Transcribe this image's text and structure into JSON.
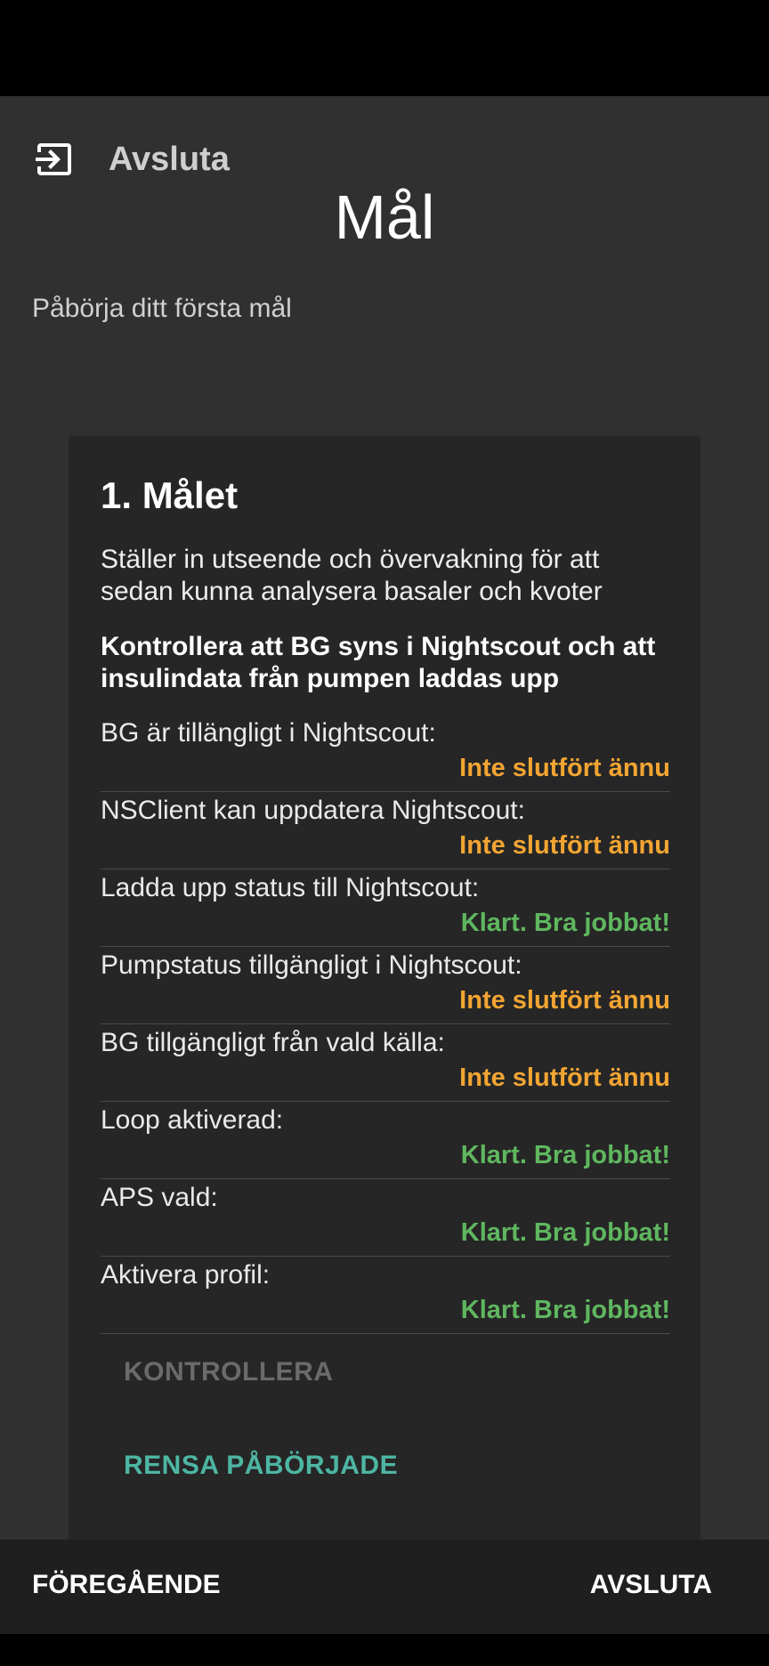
{
  "header": {
    "exit_label": "Avsluta",
    "title": "Mål",
    "subtitle": "Påbörja ditt första mål"
  },
  "objective": {
    "title": "1. Målet",
    "description": "Ställer in utseende och övervakning för att sedan kunna analysera basaler och kvoter",
    "instruction": "Kontrollera att BG syns i Nightscout och att insulindata från pumpen laddas upp",
    "tasks": [
      {
        "label": "BG är tillängligt i Nightscout:",
        "status": "Inte slutfört ännu"
      },
      {
        "label": "NSClient kan uppdatera Nightscout:",
        "status": "Inte slutfört ännu"
      },
      {
        "label": "Ladda upp status till Nightscout:",
        "status": "Klart. Bra jobbat!"
      },
      {
        "label": "Pumpstatus tillgängligt i Nightscout:",
        "status": "Inte slutfört ännu"
      },
      {
        "label": "BG tillgängligt från vald källa:",
        "status": "Inte slutfört ännu"
      },
      {
        "label": "Loop aktiverad:",
        "status": "Klart. Bra jobbat!"
      },
      {
        "label": "APS vald:",
        "status": "Klart. Bra jobbat!"
      },
      {
        "label": "Aktivera profil:",
        "status": "Klart. Bra jobbat!"
      }
    ],
    "check_button": "KONTROLLERA",
    "clear_button": "RENSA PÅBÖRJADE"
  },
  "footer": {
    "prev_label": "FÖREGÅENDE",
    "exit_label": "AVSLUTA"
  },
  "colors": {
    "pending": "#f2a533",
    "done": "#5fb75f",
    "accent": "#4db6a3"
  },
  "icons": {
    "exit": "exit-icon"
  }
}
